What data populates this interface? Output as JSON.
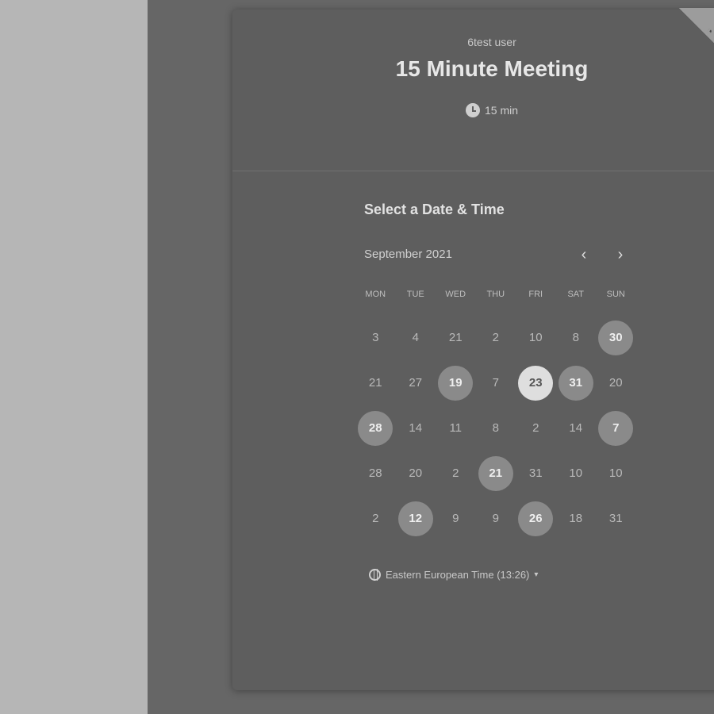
{
  "event": {
    "host": "6test user",
    "title": "15 Minute Meeting",
    "duration": "15 min"
  },
  "calendar": {
    "heading": "Select a Date & Time",
    "month": "September 2021",
    "prev_icon": "chevron-left-icon",
    "next_icon": "chevron-right-icon",
    "weekdays": [
      "MON",
      "TUE",
      "WED",
      "THU",
      "FRI",
      "SAT",
      "SUN"
    ],
    "weeks": [
      [
        {
          "label": "3",
          "state": "unavailable"
        },
        {
          "label": "4",
          "state": "unavailable"
        },
        {
          "label": "21",
          "state": "unavailable"
        },
        {
          "label": "2",
          "state": "unavailable"
        },
        {
          "label": "10",
          "state": "unavailable"
        },
        {
          "label": "8",
          "state": "unavailable"
        },
        {
          "label": "30",
          "state": "available"
        }
      ],
      [
        {
          "label": "21",
          "state": "unavailable"
        },
        {
          "label": "27",
          "state": "unavailable"
        },
        {
          "label": "19",
          "state": "available"
        },
        {
          "label": "7",
          "state": "unavailable"
        },
        {
          "label": "23",
          "state": "selected"
        },
        {
          "label": "31",
          "state": "available"
        },
        {
          "label": "20",
          "state": "unavailable"
        }
      ],
      [
        {
          "label": "28",
          "state": "available"
        },
        {
          "label": "14",
          "state": "unavailable"
        },
        {
          "label": "11",
          "state": "unavailable"
        },
        {
          "label": "8",
          "state": "unavailable"
        },
        {
          "label": "2",
          "state": "unavailable"
        },
        {
          "label": "14",
          "state": "unavailable"
        },
        {
          "label": "7",
          "state": "available"
        }
      ],
      [
        {
          "label": "28",
          "state": "unavailable"
        },
        {
          "label": "20",
          "state": "unavailable"
        },
        {
          "label": "2",
          "state": "unavailable"
        },
        {
          "label": "21",
          "state": "available"
        },
        {
          "label": "31",
          "state": "unavailable"
        },
        {
          "label": "10",
          "state": "unavailable"
        },
        {
          "label": "10",
          "state": "unavailable"
        }
      ],
      [
        {
          "label": "2",
          "state": "unavailable"
        },
        {
          "label": "12",
          "state": "available"
        },
        {
          "label": "9",
          "state": "unavailable"
        },
        {
          "label": "9",
          "state": "unavailable"
        },
        {
          "label": "26",
          "state": "available"
        },
        {
          "label": "18",
          "state": "unavailable"
        },
        {
          "label": "31",
          "state": "unavailable"
        }
      ]
    ]
  },
  "timezone": {
    "label": "Eastern European Time (13:26)",
    "icon": "globe-icon"
  },
  "corner_badge": {
    "icon": "badge-icon"
  },
  "colors": {
    "available": "#8a8a8a",
    "selected": "#dedede"
  }
}
